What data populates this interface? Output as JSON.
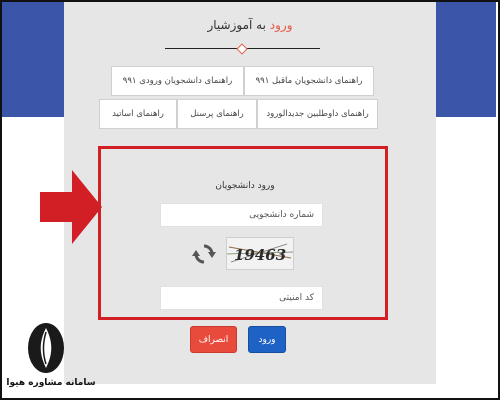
{
  "header": {
    "title_accent": "ورود",
    "title_rest": " به آموزشیار"
  },
  "guide_buttons": {
    "row1": [
      "راهنمای دانشجویان ماقبل ۹۹۱",
      "راهنمای دانشجویان ورودی ۹۹۱"
    ],
    "row2": [
      "راهنمای داوطلبین جدیدالورود",
      "راهنمای پرسنل",
      "راهنمای اساتید"
    ]
  },
  "login": {
    "title": "ورود دانشجویان",
    "student_id_placeholder": "شماره دانشجویی",
    "security_code_placeholder": "کد امنیتی",
    "captcha_text": "19463",
    "cancel_label": "انصراف",
    "submit_label": "ورود"
  },
  "icons": {
    "refresh": "refresh-icon",
    "arrow": "arrow-right-icon",
    "logo": "brand-logo"
  },
  "colors": {
    "accent": "#e25b45",
    "highlight_border": "#d21f26",
    "cancel": "#e84b3c",
    "submit": "#1e62c6",
    "banner": "#3b56a8"
  },
  "watermark": "سامانه مشاوره هیوا"
}
